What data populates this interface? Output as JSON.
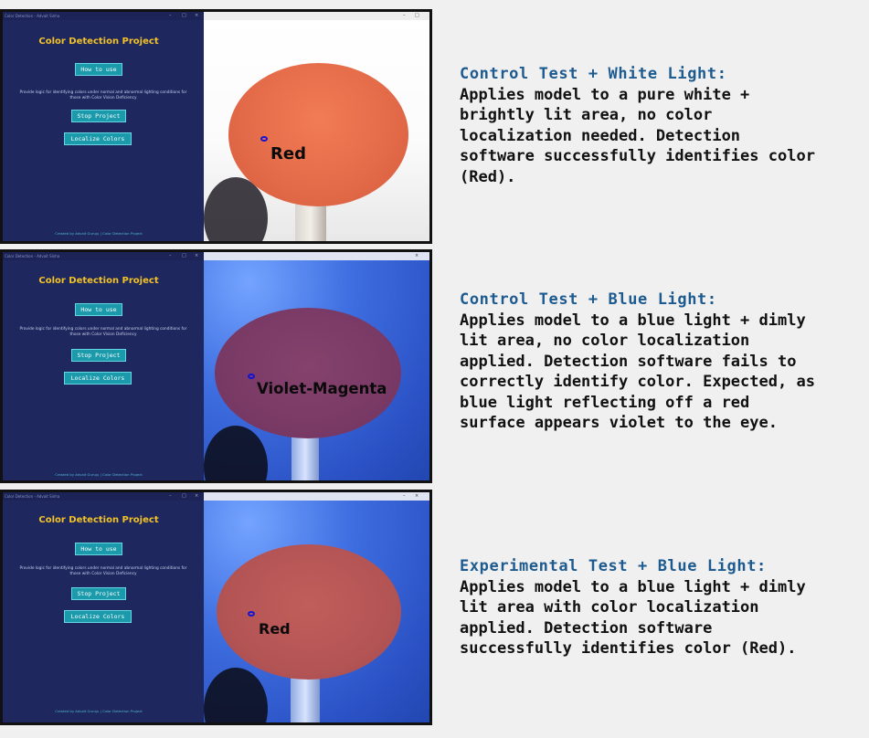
{
  "app": {
    "window_title": "Color Detection - Advait Sinha",
    "project_title": "Color Detection Project",
    "buttons": {
      "how_to_use": "How to use",
      "stop_project": "Stop Project",
      "localize_colors": "Localize Colors"
    },
    "description": "Provide logic for identifying colors under normal and abnormal lighting conditions for those with Color Vision Deficiency",
    "credit": "Created by Advait Guruju | Color Detection Project"
  },
  "panels": [
    {
      "heading": "Control Test + White Light:",
      "body_lines": [
        "Applies model to a pure white +",
        "brightly lit area, no color",
        "localization needed. Detection",
        "software successfully identifies color",
        "(Red)."
      ],
      "detected_label": "Red",
      "lighting": "white"
    },
    {
      "heading": "Control Test + Blue Light:",
      "body_lines": [
        "Applies model to a blue light + dimly",
        "lit area, no color localization",
        "applied. Detection software fails to",
        "correctly identify color. Expected, as",
        "blue light reflecting off a red",
        "surface appears violet to the eye."
      ],
      "detected_label": "Violet-Magenta",
      "lighting": "blue"
    },
    {
      "heading": "Experimental Test + Blue Light:",
      "body_lines": [
        "Applies model to a blue light + dimly",
        "lit area with color localization",
        "applied. Detection software",
        "successfully identifies color (Red)."
      ],
      "detected_label": "Red",
      "lighting": "blue"
    }
  ],
  "window_controls": {
    "minimize": "–",
    "maximize": "□",
    "close": "×"
  },
  "colors": {
    "heading_blue": "#1d5a8f",
    "panel_navy": "#1e275e",
    "title_yellow": "#f2c228",
    "button_teal": "#1a9aab"
  }
}
